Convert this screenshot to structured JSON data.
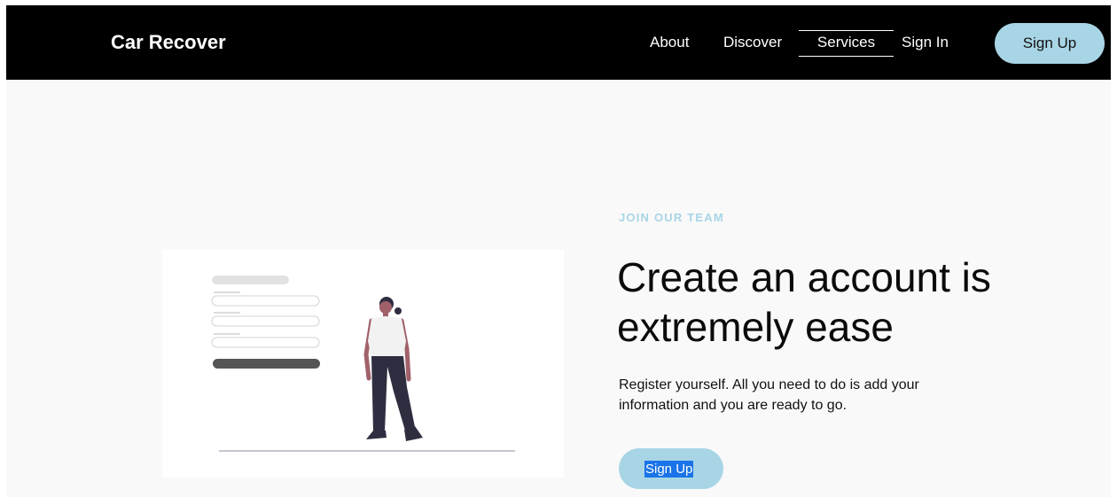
{
  "header": {
    "brand": "Car Recover",
    "nav": {
      "about": "About",
      "discover": "Discover",
      "services": "Services",
      "sign_in": "Sign In"
    },
    "signup_button": "Sign Up"
  },
  "hero": {
    "eyebrow": "JOIN OUR TEAM",
    "headline": "Create an account is extremely ease",
    "body": "Register yourself. All you need to do is add your information and you are ready to go.",
    "cta_label": "Sign Up",
    "illustration_icon": "signup-form-person-illustration"
  },
  "colors": {
    "accent": "#a8d5e5",
    "header_bg": "#000000",
    "hero_bg": "#f9f9f9",
    "text_selection": "#1a73e8"
  }
}
